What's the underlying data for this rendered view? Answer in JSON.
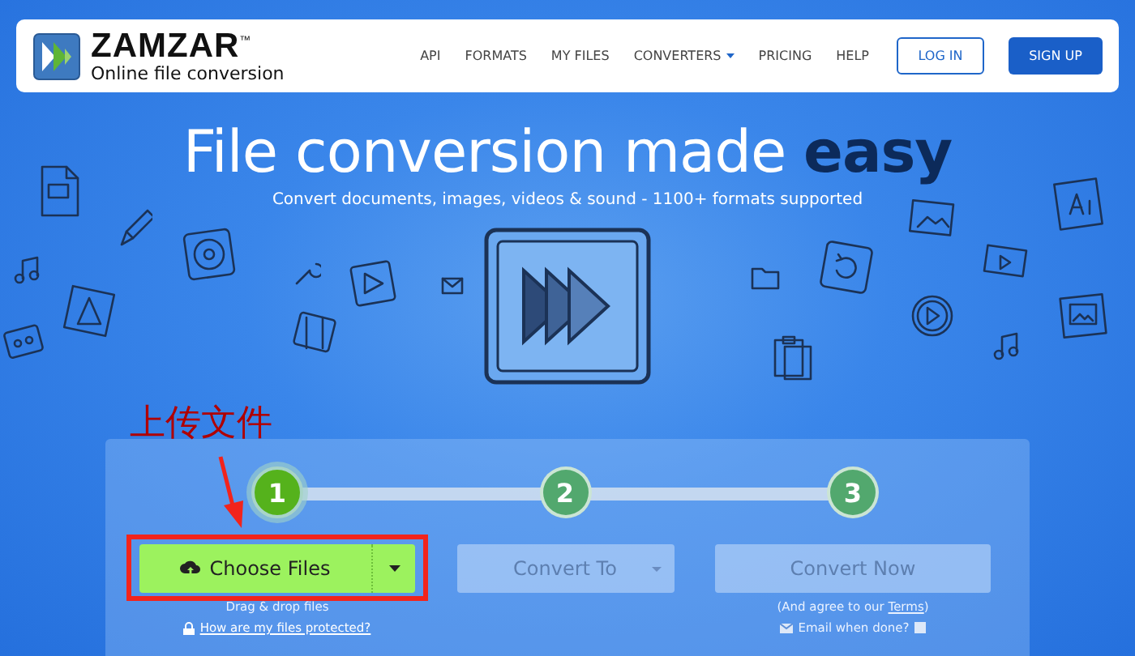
{
  "header": {
    "brand": "ZAMZAR",
    "trademark": "™",
    "tagline": "Online file conversion",
    "nav": [
      {
        "label": "API",
        "dropdown": false
      },
      {
        "label": "FORMATS",
        "dropdown": false
      },
      {
        "label": "MY FILES",
        "dropdown": false
      },
      {
        "label": "CONVERTERS",
        "dropdown": true
      },
      {
        "label": "PRICING",
        "dropdown": false
      },
      {
        "label": "HELP",
        "dropdown": false
      }
    ],
    "login": "LOG IN",
    "signup": "SIGN UP"
  },
  "hero": {
    "title": "File conversion made **easy**",
    "subtitle": "Convert documents, images, videos & sound - 1100+ formats supported"
  },
  "steps": [
    {
      "number": "1",
      "selected": true
    },
    {
      "number": "2",
      "selected": false
    },
    {
      "number": "3",
      "selected": false
    }
  ],
  "choose_files": {
    "label": "Choose Files",
    "hint": "Drag & drop files",
    "protection_link": "How are my files protected?"
  },
  "convert_to": {
    "label": "Convert To",
    "disabled": true
  },
  "convert_now": {
    "label": "Convert Now",
    "disabled": true,
    "agree_prefix": "(And agree to our ",
    "terms_link": "Terms",
    "agree_suffix": ")",
    "email_label": "Email when done?",
    "email_checked": false
  },
  "annotation": {
    "text": "上传文件"
  }
}
